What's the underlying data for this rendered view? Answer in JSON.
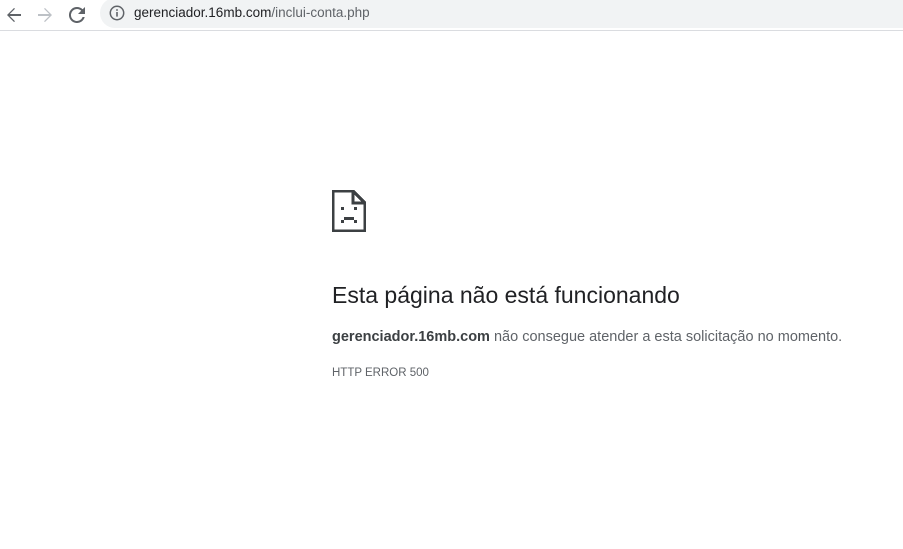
{
  "browser": {
    "url_host": "gerenciador.16mb.com",
    "url_path": "/inclui-conta.php"
  },
  "error": {
    "title": "Esta página não está funcionando",
    "host": "gerenciador.16mb.com",
    "message": " não consegue atender a esta solicitação no momento.",
    "code": "HTTP ERROR 500"
  },
  "icons": {
    "back": "arrow-left-icon",
    "forward": "arrow-right-icon",
    "reload": "reload-icon",
    "site_info": "info-icon",
    "error": "sad-page-icon"
  },
  "colors": {
    "text_primary": "#202124",
    "text_secondary": "#5f6368",
    "omnibox_bg": "#f1f3f4",
    "icon_disabled": "#bdc1c6"
  }
}
